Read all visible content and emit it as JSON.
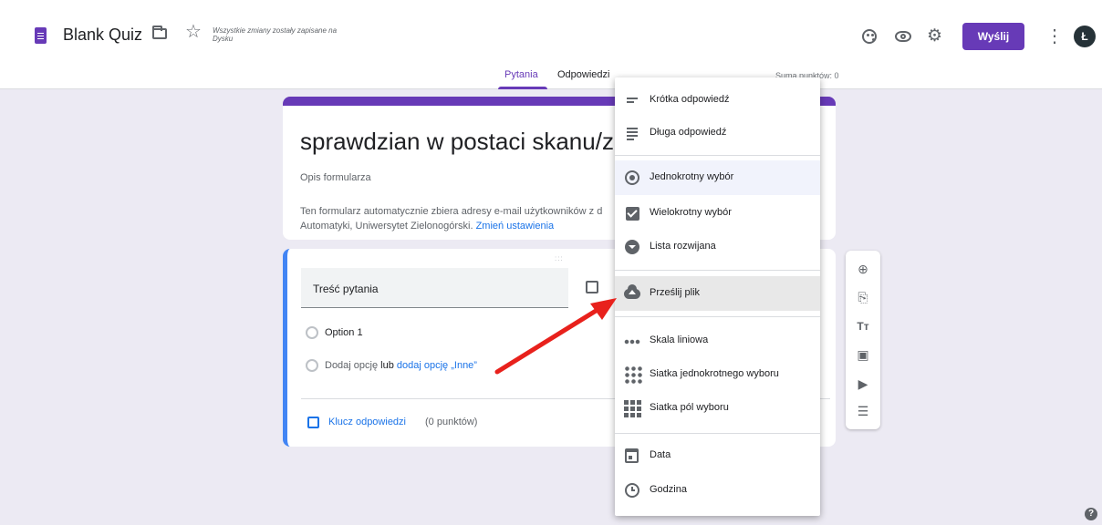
{
  "topbar": {
    "title": "Blank Quiz",
    "save_status": "Wszystkie zmiany zostały zapisane na Dysku",
    "send_label": "Wyślij",
    "avatar_initial": "Ł",
    "icons": [
      "forms-icon",
      "folder-icon",
      "star-icon",
      "palette-icon",
      "eye-icon",
      "gear-icon",
      "more-vert-icon"
    ]
  },
  "tabs": [
    {
      "label": "Pytania",
      "active": true
    },
    {
      "label": "Odpowiedzi",
      "active": false
    }
  ],
  "points_total": "Suma punktów: 0",
  "header_card": {
    "title": "sprawdzian w postaci skanu/zc",
    "description": "Opis formularza",
    "email_note": "Ten formularz automatycznie zbiera adresy e-mail użytkowników z d",
    "email_note_line2": "Automatyki, Uniwersytet Zielonogórski.",
    "change_settings_link": "Zmień ustawienia"
  },
  "question_card": {
    "drag_handle": ":::",
    "question_placeholder": "Treść pytania",
    "option1": "Option 1",
    "add_option": "Dodaj opcję",
    "or": "lub",
    "add_other": "dodaj opcję „Inne”",
    "answer_key": "Klucz odpowiedzi",
    "points": "(0 punktów)"
  },
  "toolbar": [
    "add-question-icon",
    "import-questions-icon",
    "title-text-icon",
    "image-icon",
    "video-icon",
    "section-icon"
  ],
  "menu": {
    "items": [
      {
        "label": "Krótka odpowiedź",
        "icon": "short-answer-icon"
      },
      {
        "label": "Długa odpowiedź",
        "icon": "paragraph-icon"
      },
      {
        "label": "Jednokrotny wybór",
        "icon": "radio-icon",
        "selected": true
      },
      {
        "label": "Wielokrotny wybór",
        "icon": "checkbox-icon"
      },
      {
        "label": "Lista rozwijana",
        "icon": "dropdown-icon"
      },
      {
        "label": "Prześlij plik",
        "icon": "cloud-upload-icon",
        "hover": true
      },
      {
        "label": "Skala liniowa",
        "icon": "linear-scale-icon"
      },
      {
        "label": "Siatka jednokrotnego wyboru",
        "icon": "radio-grid-icon"
      },
      {
        "label": "Siatka pól wyboru",
        "icon": "checkbox-grid-icon"
      },
      {
        "label": "Data",
        "icon": "calendar-icon"
      },
      {
        "label": "Godzina",
        "icon": "clock-icon"
      }
    ]
  },
  "help_glyph": "?",
  "colors": {
    "accent": "#673ab7",
    "link": "#1a73e8",
    "arrow": "#e8211c",
    "background": "#eceaf3"
  }
}
